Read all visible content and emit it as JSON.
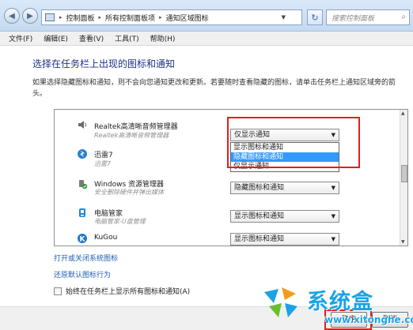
{
  "address_bar": {
    "breadcrumbs": [
      "控制面板",
      "所有控制面板项",
      "通知区域图标"
    ],
    "search_placeholder": "搜索控制面板"
  },
  "menu": [
    "文件(F)",
    "编辑(E)",
    "查看(V)",
    "工具(T)",
    "帮助(H)"
  ],
  "main": {
    "title": "选择在任务栏上出现的图标和通知",
    "description": "如果选择隐藏图标和通知，则不会向您通知更改和更新。若要随时查看隐藏的图标，请单击任务栏上通知区域旁的箭头。"
  },
  "icons": [
    {
      "name": "Realtek高清晰音频管理器",
      "subtitle": "Realtek高清晰音频管理器",
      "behavior": "仅显示通知",
      "icon": "speaker-icon",
      "dropdown_open": true,
      "options": [
        "显示图标和通知",
        "隐藏图标和通知",
        "仅显示通知"
      ],
      "highlighted_option": "隐藏图标和通知"
    },
    {
      "name": "迅雷7",
      "subtitle": "迅雷7",
      "behavior": "",
      "icon": "thunder-icon"
    },
    {
      "name": "Windows 资源管理器",
      "subtitle": "安全删除硬件并弹出媒体",
      "behavior": "隐藏图标和通知",
      "icon": "usb-eject-icon"
    },
    {
      "name": "电脑管家",
      "subtitle": "电脑管家-U盘管理",
      "behavior": "显示图标和通知",
      "icon": "pc-manager-icon"
    },
    {
      "name": "KuGou",
      "subtitle": "",
      "behavior": "显示图标和通知",
      "icon": "kugou-icon"
    }
  ],
  "links": {
    "toggle_system_icons": "打开或关闭系统图标",
    "restore_defaults": "还原默认图标行为"
  },
  "always_show": {
    "label": "始终在任务栏上显示所有图标和通知(A)",
    "checked": false
  },
  "buttons": {
    "ok": "确定",
    "cancel": "取消"
  },
  "watermark": {
    "brand": "系统盒",
    "url": "www.xitonghe.com"
  },
  "colors": {
    "highlight": "#e01f1f",
    "link": "#1e5fb4",
    "title": "#1e3287",
    "selection": "#3399ff",
    "watermark": "#1aa3e6"
  }
}
